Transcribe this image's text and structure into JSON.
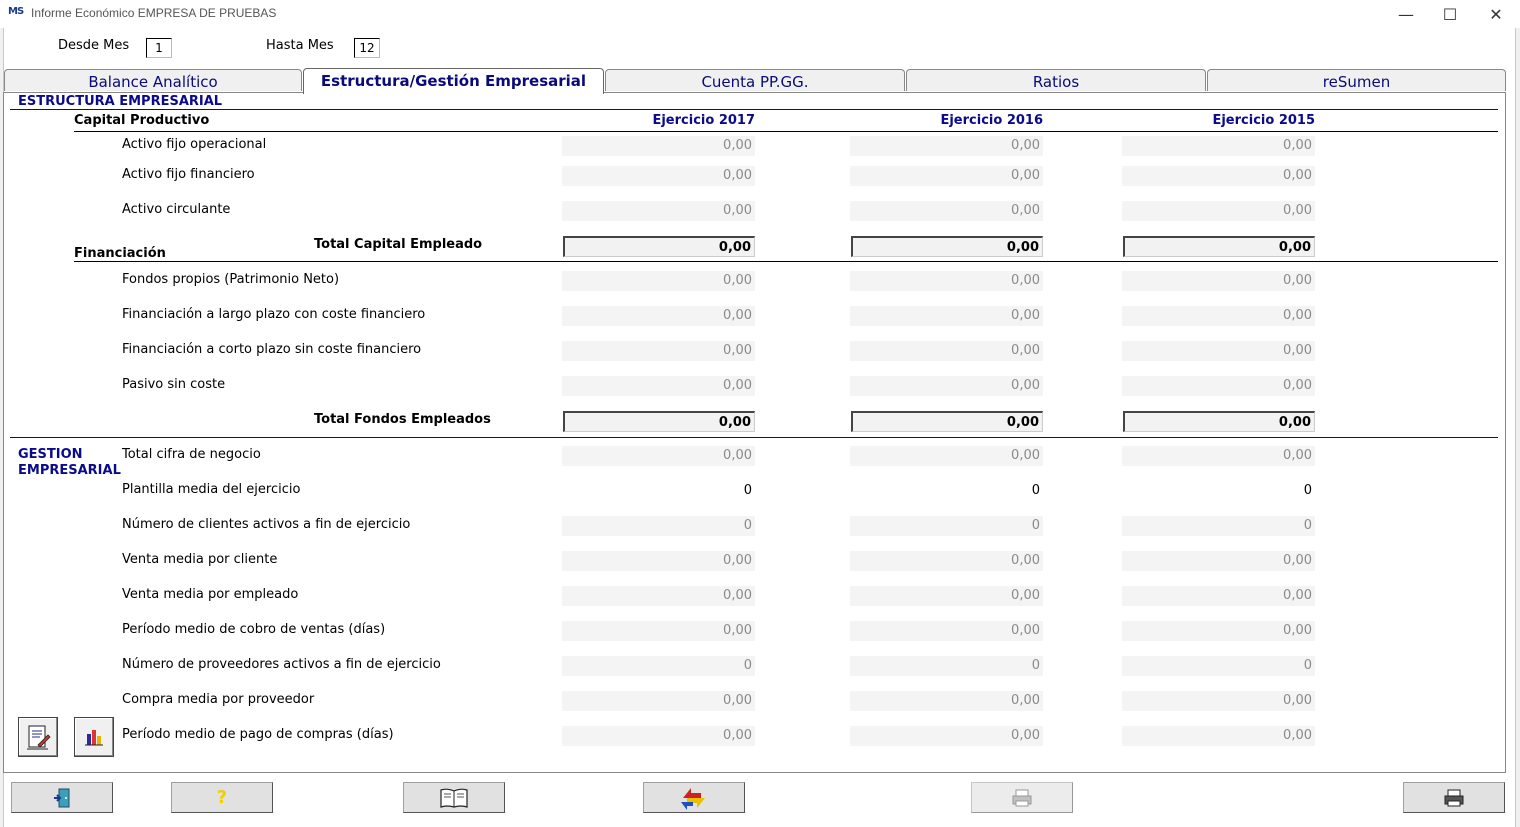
{
  "window": {
    "app_badge": "MS",
    "title": "Informe Económico EMPRESA DE PRUEBAS",
    "minimize": "—",
    "maximize": "☐",
    "close": "✕"
  },
  "filter": {
    "desde_label": "Desde Mes",
    "desde_value": "1",
    "hasta_label": "Hasta Mes",
    "hasta_value": "12"
  },
  "tabs": [
    {
      "label": "Balance Analítico",
      "active": false
    },
    {
      "label": "Estructura/Gestión Empresarial",
      "active": true
    },
    {
      "label": "Cuenta PP.GG.",
      "active": false
    },
    {
      "label": "Ratios",
      "active": false
    },
    {
      "label": "reSumen",
      "active": false
    }
  ],
  "estructura": {
    "section_title": "ESTRUCTURA EMPRESARIAL",
    "capital_title": "Capital Productivo",
    "columns": [
      "Ejercicio 2017",
      "Ejercicio 2016",
      "Ejercicio 2015"
    ],
    "capital_rows": [
      {
        "label": "Activo fijo operacional",
        "values": [
          "0,00",
          "0,00",
          "0,00"
        ]
      },
      {
        "label": "Activo fijo financiero",
        "values": [
          "0,00",
          "0,00",
          "0,00"
        ]
      },
      {
        "label": "Activo circulante",
        "values": [
          "0,00",
          "0,00",
          "0,00"
        ]
      }
    ],
    "total_capital_label": "Total Capital Empleado",
    "total_capital": [
      "0,00",
      "0,00",
      "0,00"
    ],
    "financiacion_title": "Financiación",
    "financiacion_rows": [
      {
        "label": "Fondos propios (Patrimonio Neto)",
        "values": [
          "0,00",
          "0,00",
          "0,00"
        ]
      },
      {
        "label": "Financiación a largo plazo con coste financiero",
        "values": [
          "0,00",
          "0,00",
          "0,00"
        ]
      },
      {
        "label": "Financiación a corto plazo sin coste financiero",
        "values": [
          "0,00",
          "0,00",
          "0,00"
        ]
      },
      {
        "label": "Pasivo sin coste",
        "values": [
          "0,00",
          "0,00",
          "0,00"
        ]
      }
    ],
    "total_fondos_label": "Total Fondos Empleados",
    "total_fondos": [
      "0,00",
      "0,00",
      "0,00"
    ]
  },
  "gestion": {
    "section_title_1": "GESTION",
    "section_title_2": "EMPRESARIAL",
    "rows": [
      {
        "label": "Total cifra de negocio",
        "values": [
          "0,00",
          "0,00",
          "0,00"
        ],
        "editable": false
      },
      {
        "label": "Plantilla media del ejercicio",
        "values": [
          "0",
          "0",
          "0"
        ],
        "editable": true
      },
      {
        "label": "Número de clientes activos a fin de ejercicio",
        "values": [
          "0",
          "0",
          "0"
        ],
        "editable": false
      },
      {
        "label": "Venta media por cliente",
        "values": [
          "0,00",
          "0,00",
          "0,00"
        ],
        "editable": false
      },
      {
        "label": "Venta media por empleado",
        "values": [
          "0,00",
          "0,00",
          "0,00"
        ],
        "editable": false
      },
      {
        "label": "Período medio de cobro de ventas (días)",
        "values": [
          "0,00",
          "0,00",
          "0,00"
        ],
        "editable": false
      },
      {
        "label": "Número de proveedores activos a fin de ejercicio",
        "values": [
          "0",
          "0",
          "0"
        ],
        "editable": false
      },
      {
        "label": "Compra media por proveedor",
        "values": [
          "0,00",
          "0,00",
          "0,00"
        ],
        "editable": false
      },
      {
        "label": "Período medio de pago de compras (días)",
        "values": [
          "0,00",
          "0,00",
          "0,00"
        ],
        "editable": false
      }
    ]
  },
  "side_buttons": [
    {
      "icon": "document-edit-icon"
    },
    {
      "icon": "bar-chart-icon"
    }
  ],
  "toolbar": {
    "exit_icon": "exit-door-icon",
    "help_glyph": "?",
    "book_icon": "book-icon",
    "refresh_icon": "refresh-arrows-icon",
    "printer_disabled_icon": "printer-icon",
    "printer_icon": "printer-icon"
  },
  "colors": {
    "accent_blue": "#0a0a8a",
    "readonly_bg": "#f4f4f4",
    "readonly_text": "#8a8a8a"
  }
}
